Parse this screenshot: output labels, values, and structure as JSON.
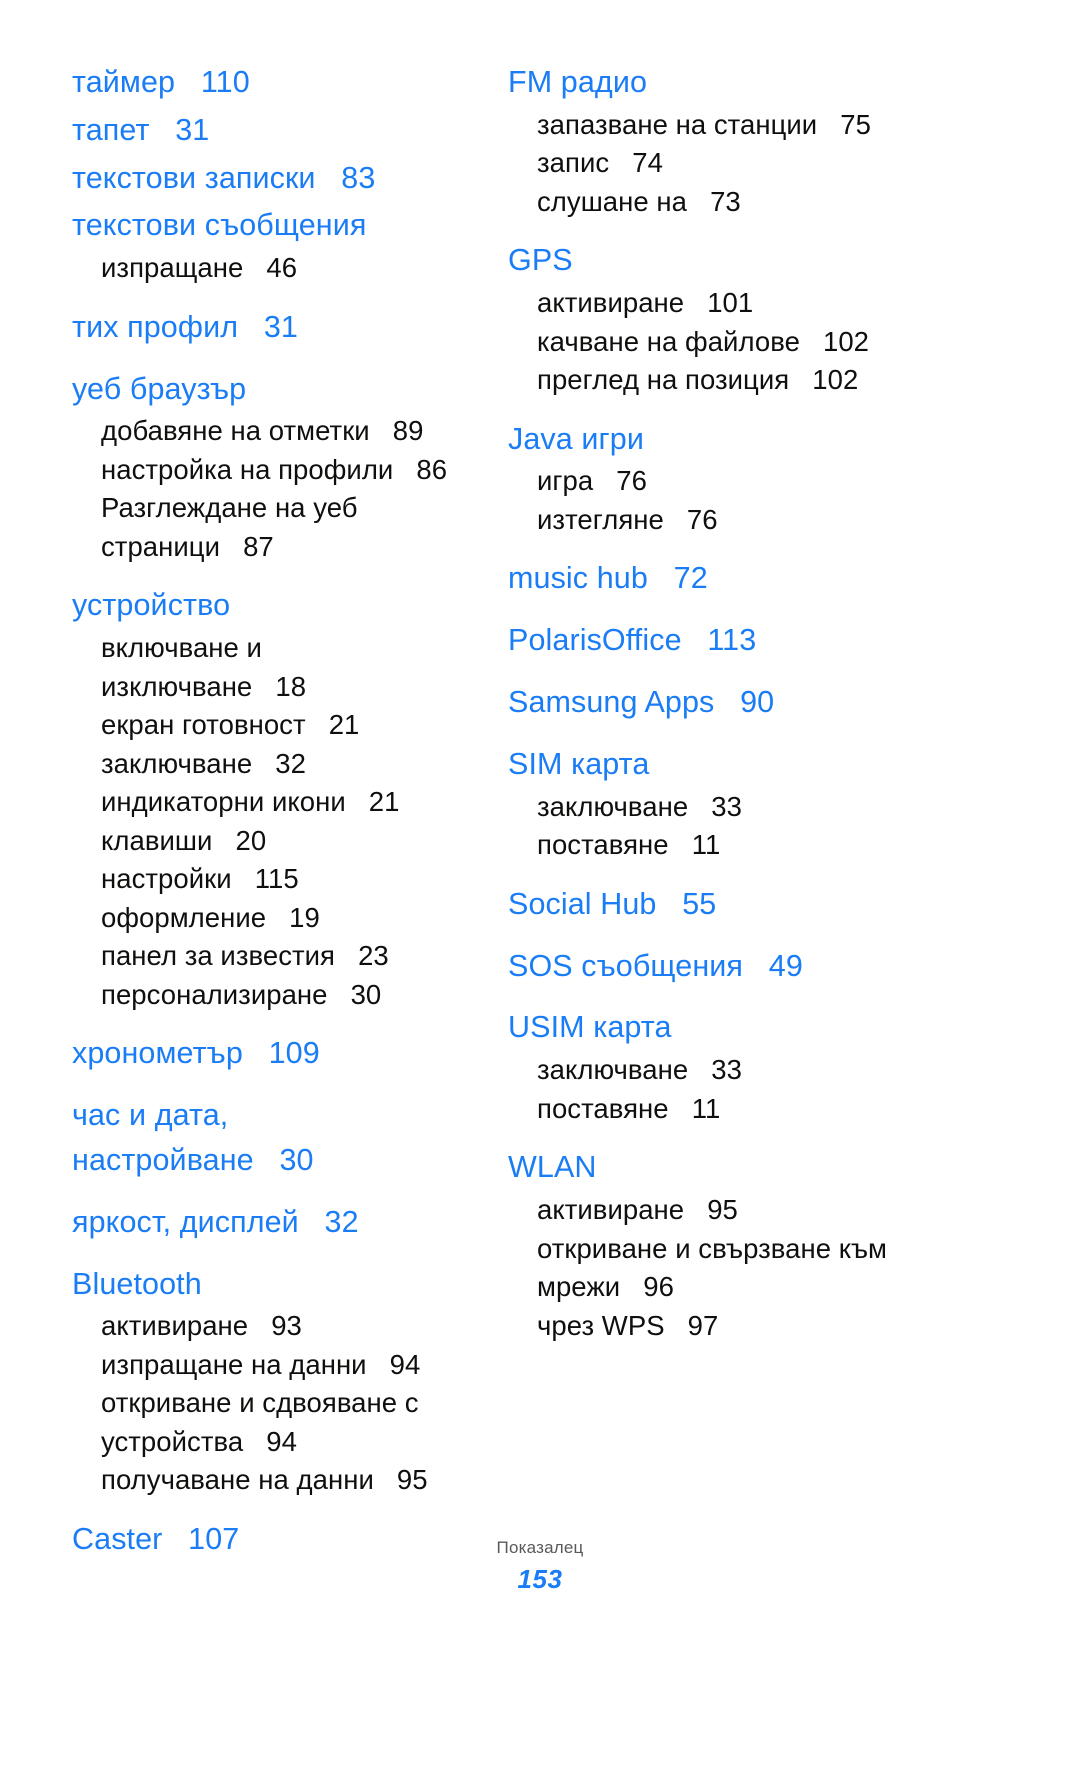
{
  "document": {
    "footer_label": "Показалец",
    "page_number": "153",
    "accent_color": "#1a7df5",
    "text_color": "#100f0d",
    "footer_label_color": "#58595b"
  },
  "left_column": {
    "entries": [
      {
        "term": "таймер",
        "page": "110",
        "tight": true,
        "subs": []
      },
      {
        "term": "тапет",
        "page": "31",
        "tight": true,
        "subs": []
      },
      {
        "term": "текстови записки",
        "page": "83",
        "tight": true,
        "subs": []
      },
      {
        "term": "текстови съобщения",
        "page": "",
        "tight": true,
        "subs": [
          {
            "label": "изпращане",
            "page": "46"
          }
        ]
      },
      {
        "term": "тих профил",
        "page": "31",
        "tight": false,
        "subs": []
      },
      {
        "term": "уеб браузър",
        "page": "",
        "tight": false,
        "subs": [
          {
            "label": "добавяне на отметки",
            "page": "89"
          },
          {
            "label": "настройка на профили",
            "page": "86"
          },
          {
            "label": "Разглеждане на уеб",
            "page": ""
          },
          {
            "label": "страници",
            "page": "87"
          }
        ]
      },
      {
        "term": "устройство",
        "page": "",
        "tight": false,
        "subs": [
          {
            "label": "включване и",
            "page": ""
          },
          {
            "label": "изключване",
            "page": "18"
          },
          {
            "label": "екран готовност",
            "page": "21"
          },
          {
            "label": "заключване",
            "page": "32"
          },
          {
            "label": "индикаторни икони",
            "page": "21"
          },
          {
            "label": "клавиши",
            "page": "20"
          },
          {
            "label": "настройки",
            "page": "115"
          },
          {
            "label": "оформление",
            "page": "19"
          },
          {
            "label": "панел за известия",
            "page": "23"
          },
          {
            "label": "персонализиране",
            "page": "30"
          }
        ]
      },
      {
        "term": "хронометър",
        "page": "109",
        "tight": false,
        "subs": []
      },
      {
        "term": "час и дата,\nнастройване",
        "page": "30",
        "tight": false,
        "subs": []
      },
      {
        "term": "яркост, дисплей",
        "page": "32",
        "tight": false,
        "subs": []
      },
      {
        "term": "Bluetooth",
        "page": "",
        "tight": false,
        "subs": [
          {
            "label": "активиране",
            "page": "93"
          },
          {
            "label": "изпращане на данни",
            "page": "94"
          },
          {
            "label": "откриване и сдвояване с",
            "page": ""
          },
          {
            "label": "устройства",
            "page": "94"
          },
          {
            "label": "получаване на данни",
            "page": "95"
          }
        ]
      },
      {
        "term": "Caster",
        "page": "107",
        "tight": false,
        "subs": []
      }
    ]
  },
  "right_column": {
    "entries": [
      {
        "term": "FM радио",
        "page": "",
        "tight": false,
        "subs": [
          {
            "label": "запазване на станции",
            "page": "75"
          },
          {
            "label": "запис",
            "page": "74"
          },
          {
            "label": "слушане на",
            "page": "73"
          }
        ]
      },
      {
        "term": "GPS",
        "page": "",
        "tight": false,
        "subs": [
          {
            "label": "активиране",
            "page": "101"
          },
          {
            "label": "качване на файлове",
            "page": "102"
          },
          {
            "label": "преглед на позиция",
            "page": "102"
          }
        ]
      },
      {
        "term": "Java игри",
        "page": "",
        "tight": false,
        "subs": [
          {
            "label": "игра",
            "page": "76"
          },
          {
            "label": "изтегляне",
            "page": "76"
          }
        ]
      },
      {
        "term": "music hub",
        "page": "72",
        "tight": false,
        "subs": []
      },
      {
        "term": "PolarisOffice",
        "page": "113",
        "tight": false,
        "subs": []
      },
      {
        "term": "Samsung Apps",
        "page": "90",
        "tight": false,
        "subs": []
      },
      {
        "term": "SIM карта",
        "page": "",
        "tight": false,
        "subs": [
          {
            "label": "заключване",
            "page": "33"
          },
          {
            "label": "поставяне",
            "page": "11"
          }
        ]
      },
      {
        "term": "Social Hub",
        "page": "55",
        "tight": false,
        "subs": []
      },
      {
        "term": "SOS съобщения",
        "page": "49",
        "tight": false,
        "subs": []
      },
      {
        "term": "USIM карта",
        "page": "",
        "tight": false,
        "subs": [
          {
            "label": "заключване",
            "page": "33"
          },
          {
            "label": "поставяне",
            "page": "11"
          }
        ]
      },
      {
        "term": "WLAN",
        "page": "",
        "tight": false,
        "subs": [
          {
            "label": "активиране",
            "page": "95"
          },
          {
            "label": "откриване и свързване към",
            "page": ""
          },
          {
            "label": "мрежи",
            "page": "96"
          },
          {
            "label": "чрез WPS",
            "page": "97"
          }
        ]
      }
    ]
  }
}
